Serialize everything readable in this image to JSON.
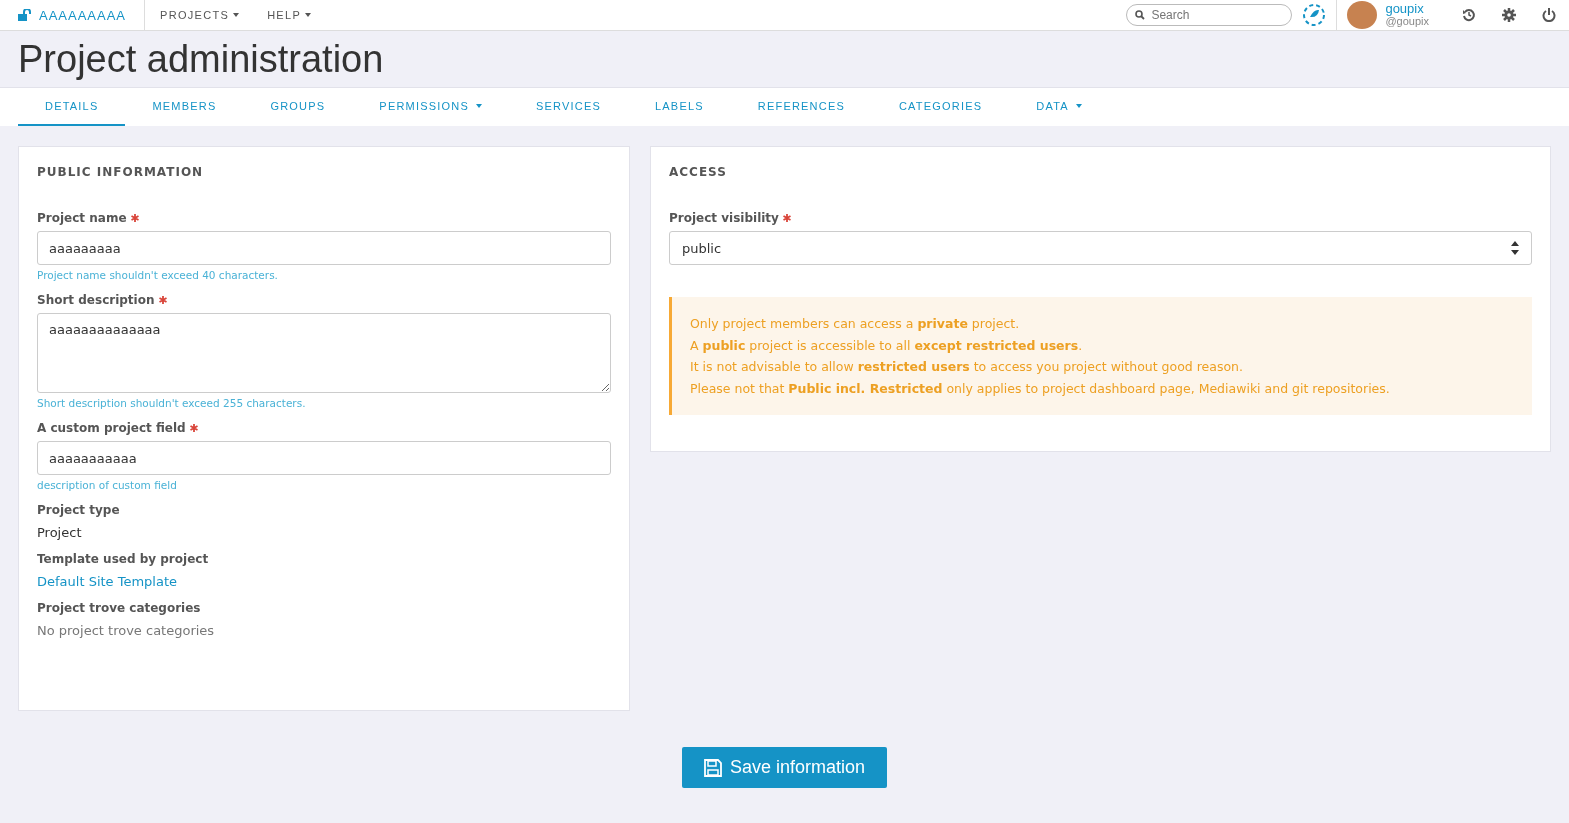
{
  "navbar": {
    "project": "AAAAAAAAA",
    "menus": [
      {
        "label": "PROJECTS",
        "dropdown": true
      },
      {
        "label": "HELP",
        "dropdown": true
      }
    ],
    "search": {
      "placeholder": "Search"
    },
    "user": {
      "name": "goupix",
      "handle": "@goupix"
    }
  },
  "title": "Project administration",
  "tabs": [
    {
      "label": "DETAILS",
      "selected": true,
      "dropdown": false
    },
    {
      "label": "MEMBERS",
      "selected": false,
      "dropdown": false
    },
    {
      "label": "GROUPS",
      "selected": false,
      "dropdown": false
    },
    {
      "label": "PERMISSIONS",
      "selected": false,
      "dropdown": true
    },
    {
      "label": "SERVICES",
      "selected": false,
      "dropdown": false
    },
    {
      "label": "LABELS",
      "selected": false,
      "dropdown": false
    },
    {
      "label": "REFERENCES",
      "selected": false,
      "dropdown": false
    },
    {
      "label": "CATEGORIES",
      "selected": false,
      "dropdown": false
    },
    {
      "label": "DATA",
      "selected": false,
      "dropdown": true
    }
  ],
  "public_information": {
    "heading": "PUBLIC INFORMATION",
    "fields": [
      {
        "kind": "input",
        "label": "Project name",
        "required": true,
        "value": "aaaaaaaaa",
        "help": "Project name shouldn't exceed 40 characters."
      },
      {
        "kind": "textarea",
        "label": "Short description",
        "required": true,
        "value": "aaaaaaaaaaaaaa",
        "help": "Short description shouldn't exceed 255 characters."
      },
      {
        "kind": "input",
        "label": "A custom project field",
        "required": true,
        "value": "aaaaaaaaaaa",
        "help": "description of custom field"
      },
      {
        "kind": "text",
        "label": "Project type",
        "value": "Project"
      },
      {
        "kind": "link",
        "label": "Template used by project",
        "value": "Default Site Template"
      },
      {
        "kind": "muted",
        "label": "Project trove categories",
        "value": "No project trove categories"
      }
    ]
  },
  "access": {
    "heading": "ACCESS",
    "visibility": {
      "label": "Project visibility",
      "required": true,
      "value": "public"
    },
    "notice": [
      "Only project members can access a **private** project.",
      "A **public** project is accessible to all **except restricted users**.",
      "It is not advisable to allow **restricted users** to access you project without good reason.",
      "Please not that **Public incl. Restricted** only applies to project dashboard page, Mediawiki and git repositories."
    ]
  },
  "save_button": "Save information"
}
